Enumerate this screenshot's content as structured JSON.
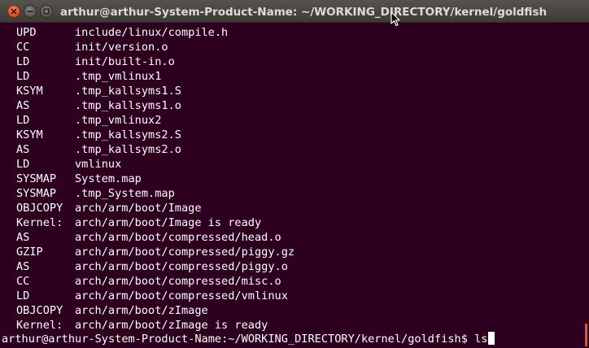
{
  "window": {
    "title": "arthur@arthur-System-Product-Name: ~/WORKING_DIRECTORY/kernel/goldfish",
    "close_icon": "close-icon",
    "minimize_icon": "minimize-icon",
    "maximize_icon": "maximize-icon"
  },
  "terminal": {
    "lines": [
      {
        "tag": "UPD",
        "text": "include/linux/compile.h"
      },
      {
        "tag": "CC",
        "text": "init/version.o"
      },
      {
        "tag": "LD",
        "text": "init/built-in.o"
      },
      {
        "tag": "LD",
        "text": ".tmp_vmlinux1"
      },
      {
        "tag": "KSYM",
        "text": ".tmp_kallsyms1.S"
      },
      {
        "tag": "AS",
        "text": ".tmp_kallsyms1.o"
      },
      {
        "tag": "LD",
        "text": ".tmp_vmlinux2"
      },
      {
        "tag": "KSYM",
        "text": ".tmp_kallsyms2.S"
      },
      {
        "tag": "AS",
        "text": ".tmp_kallsyms2.o"
      },
      {
        "tag": "LD",
        "text": "vmlinux"
      },
      {
        "tag": "SYSMAP",
        "text": "System.map"
      },
      {
        "tag": "SYSMAP",
        "text": ".tmp_System.map"
      },
      {
        "tag": "OBJCOPY",
        "text": "arch/arm/boot/Image"
      },
      {
        "tag": "Kernel:",
        "text": "arch/arm/boot/Image is ready"
      },
      {
        "tag": "AS",
        "text": "arch/arm/boot/compressed/head.o"
      },
      {
        "tag": "GZIP",
        "text": "arch/arm/boot/compressed/piggy.gz"
      },
      {
        "tag": "AS",
        "text": "arch/arm/boot/compressed/piggy.o"
      },
      {
        "tag": "CC",
        "text": "arch/arm/boot/compressed/misc.o"
      },
      {
        "tag": "LD",
        "text": "arch/arm/boot/compressed/vmlinux"
      },
      {
        "tag": "OBJCOPY",
        "text": "arch/arm/boot/zImage"
      },
      {
        "tag": "Kernel:",
        "text": "arch/arm/boot/zImage is ready"
      }
    ],
    "prompt": "arthur@arthur-System-Product-Name:~/WORKING_DIRECTORY/kernel/goldfish$",
    "command": "ls"
  },
  "colors": {
    "background": "#2c001e",
    "text": "#ffffff",
    "titlebar": "#3d3b37",
    "close_button": "#e4521f"
  }
}
